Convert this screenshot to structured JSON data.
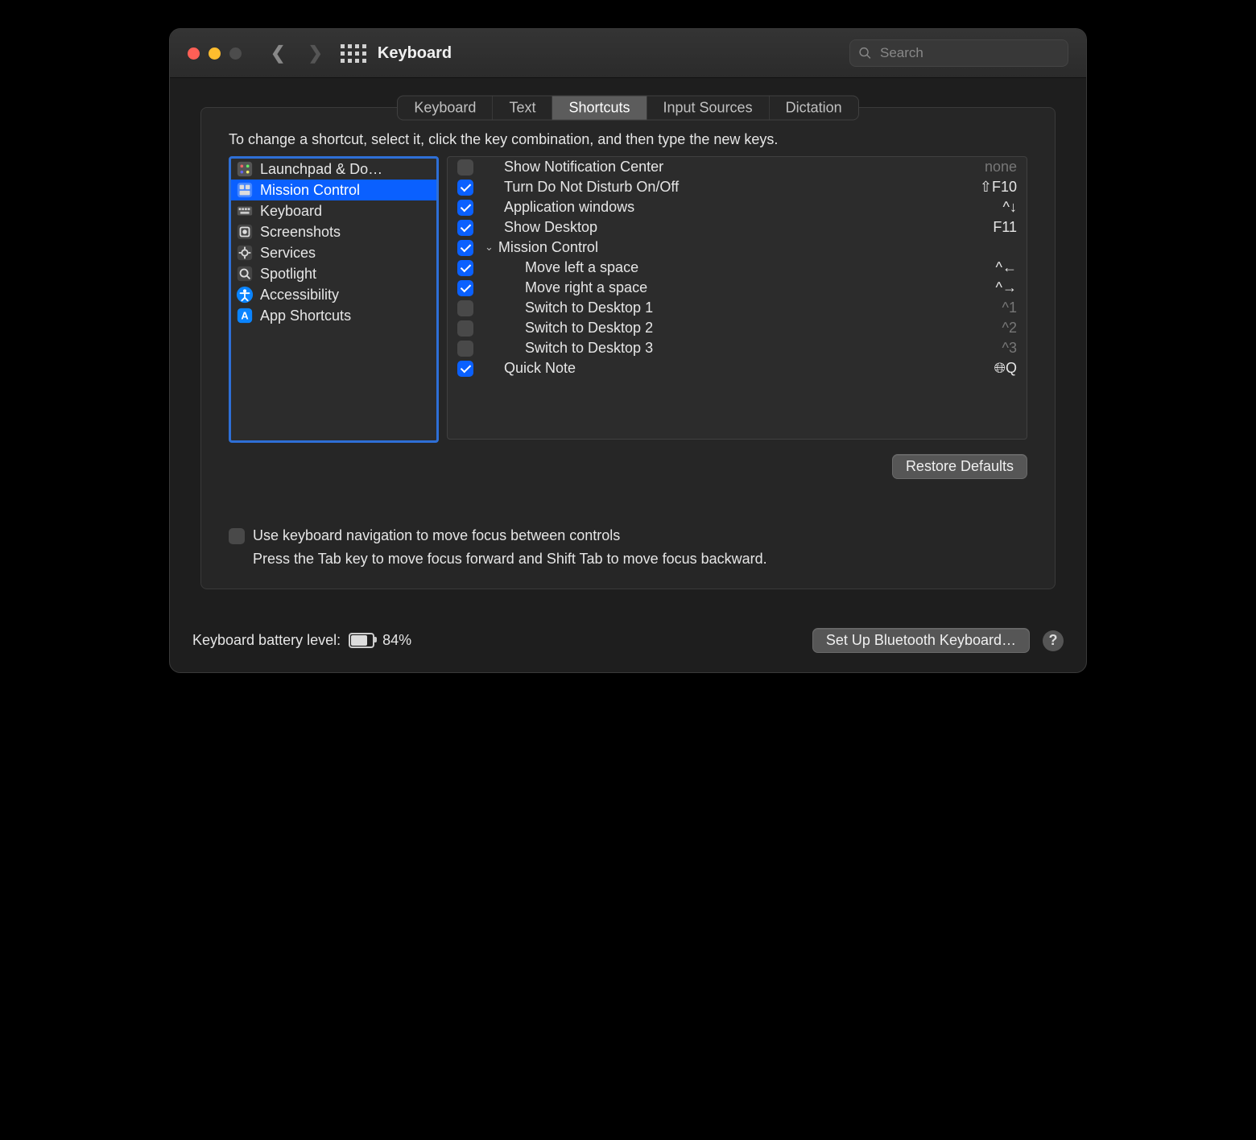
{
  "window": {
    "title": "Keyboard"
  },
  "search": {
    "placeholder": "Search"
  },
  "tabs": {
    "items": [
      {
        "label": "Keyboard",
        "selected": false
      },
      {
        "label": "Text",
        "selected": false
      },
      {
        "label": "Shortcuts",
        "selected": true
      },
      {
        "label": "Input Sources",
        "selected": false
      },
      {
        "label": "Dictation",
        "selected": false
      }
    ]
  },
  "instruction": "To change a shortcut, select it, click the key combination, and then type the new keys.",
  "categories": [
    {
      "label": "Launchpad & Do…",
      "selected": false,
      "icon": "launchpad"
    },
    {
      "label": "Mission Control",
      "selected": true,
      "icon": "mission"
    },
    {
      "label": "Keyboard",
      "selected": false,
      "icon": "keyboard"
    },
    {
      "label": "Screenshots",
      "selected": false,
      "icon": "screenshot"
    },
    {
      "label": "Services",
      "selected": false,
      "icon": "gear"
    },
    {
      "label": "Spotlight",
      "selected": false,
      "icon": "spotlight"
    },
    {
      "label": "Accessibility",
      "selected": false,
      "icon": "accessibility"
    },
    {
      "label": "App Shortcuts",
      "selected": false,
      "icon": "app"
    }
  ],
  "shortcuts": [
    {
      "checked": false,
      "indent": 0,
      "label": "Show Notification Center",
      "key": "none",
      "disclosure": false,
      "key_dim": true
    },
    {
      "checked": true,
      "indent": 0,
      "label": "Turn Do Not Disturb On/Off",
      "key": "⇧F10",
      "disclosure": false,
      "key_dim": false
    },
    {
      "checked": true,
      "indent": 0,
      "label": "Application windows",
      "key": "^↓",
      "disclosure": false,
      "key_dim": false
    },
    {
      "checked": true,
      "indent": 0,
      "label": "Show Desktop",
      "key": "F11",
      "disclosure": false,
      "key_dim": false
    },
    {
      "checked": true,
      "indent": 0,
      "label": "Mission Control",
      "key": "",
      "disclosure": true,
      "key_dim": false
    },
    {
      "checked": true,
      "indent": 1,
      "label": "Move left a space",
      "key": "^←",
      "disclosure": false,
      "key_dim": false
    },
    {
      "checked": true,
      "indent": 1,
      "label": "Move right a space",
      "key": "^→",
      "disclosure": false,
      "key_dim": false
    },
    {
      "checked": false,
      "indent": 1,
      "label": "Switch to Desktop 1",
      "key": "^1",
      "disclosure": false,
      "key_dim": true
    },
    {
      "checked": false,
      "indent": 1,
      "label": "Switch to Desktop 2",
      "key": "^2",
      "disclosure": false,
      "key_dim": true
    },
    {
      "checked": false,
      "indent": 1,
      "label": "Switch to Desktop 3",
      "key": "^3",
      "disclosure": false,
      "key_dim": true
    },
    {
      "checked": true,
      "indent": 0,
      "label": "Quick Note",
      "key": "🌐︎Q",
      "disclosure": false,
      "key_dim": false
    }
  ],
  "restore_defaults": "Restore Defaults",
  "fkn": {
    "checked": false,
    "label": "Use keyboard navigation to move focus between controls",
    "sub": "Press the Tab key to move focus forward and Shift Tab to move focus backward."
  },
  "footer": {
    "battery_label": "Keyboard battery level:",
    "battery_pct_text": "84%",
    "battery_pct": 84,
    "bluetooth_button": "Set Up Bluetooth Keyboard…",
    "help": "?"
  }
}
